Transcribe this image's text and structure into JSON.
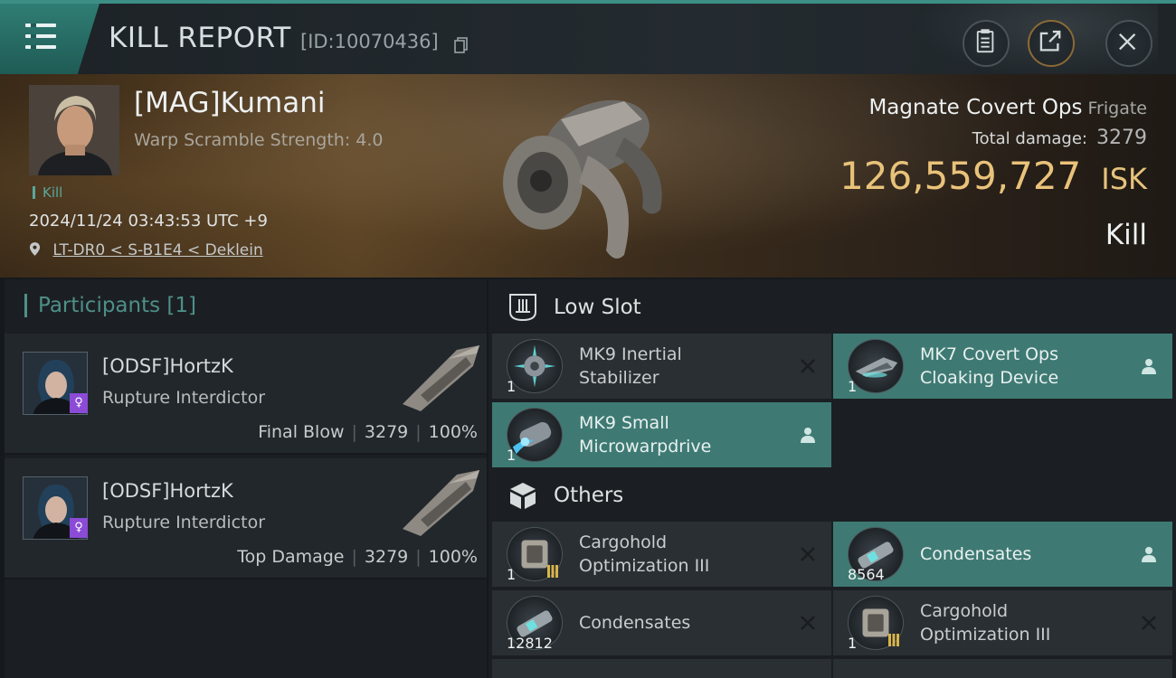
{
  "header": {
    "title": "KILL REPORT",
    "report_id": "[ID:10070436]"
  },
  "victim": {
    "pilot": "[MAG]Kumani",
    "warp_scramble": "Warp Scramble Strength: 4.0",
    "tag": "Kill",
    "timestamp": "2024/11/24 03:43:53 UTC +9",
    "location": "LT-DR0 < S-B1E4 < Deklein",
    "ship_name": "Magnate Covert Ops",
    "ship_class": "Frigate",
    "total_damage_label": "Total damage:",
    "total_damage": "3279",
    "isk_value": "126,559,727",
    "isk_unit": "ISK",
    "result": "Kill"
  },
  "participants": {
    "header": "Participants [1]",
    "items": [
      {
        "name": "[ODSF]HortzK",
        "ship": "Rupture Interdictor",
        "role": "Final Blow",
        "damage": "3279",
        "percent": "100%"
      },
      {
        "name": "[ODSF]HortzK",
        "ship": "Rupture Interdictor",
        "role": "Top Damage",
        "damage": "3279",
        "percent": "100%"
      }
    ]
  },
  "fitting": {
    "low_slot": {
      "title": "Low Slot",
      "items": [
        {
          "name_1": "MK9 Inertial",
          "name_2": "Stabilizer",
          "qty": "1",
          "status": "destroyed"
        },
        {
          "name_1": "MK7 Covert Ops",
          "name_2": "Cloaking Device",
          "qty": "1",
          "status": "dropped"
        },
        {
          "name_1": "MK9 Small",
          "name_2": "Microwarpdrive",
          "qty": "1",
          "status": "dropped"
        }
      ]
    },
    "others": {
      "title": "Others",
      "items": [
        {
          "name_1": "Cargohold",
          "name_2": "Optimization III",
          "qty": "1",
          "status": "destroyed"
        },
        {
          "name_1": "Condensates",
          "name_2": "",
          "qty": "8564",
          "status": "dropped"
        },
        {
          "name_1": "Condensates",
          "name_2": "",
          "qty": "12812",
          "status": "destroyed"
        },
        {
          "name_1": "Cargohold",
          "name_2": "Optimization III",
          "qty": "1",
          "status": "destroyed"
        }
      ]
    }
  },
  "icons": {
    "menu": "menu-icon",
    "copy": "copy-icon",
    "clipboard": "clipboard-icon",
    "share": "share-icon",
    "close": "close-icon",
    "location": "location-pin-icon",
    "destroyed": "x-icon",
    "dropped": "person-icon"
  },
  "colors": {
    "accent": "#3e7a73",
    "isk": "#e9c27a",
    "badge": "#8b4bd6"
  }
}
